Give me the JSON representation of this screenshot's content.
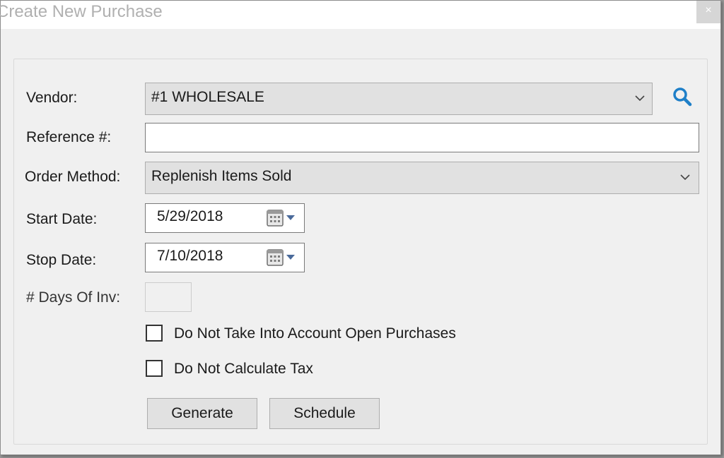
{
  "window": {
    "title": "Create New Purchase",
    "close_glyph": "×"
  },
  "form": {
    "vendor": {
      "label": "Vendor:",
      "value": "#1 WHOLESALE",
      "search_icon": "search-icon"
    },
    "reference": {
      "label": "Reference #:",
      "value": ""
    },
    "order_method": {
      "label": "Order Method:",
      "value": "Replenish Items Sold"
    },
    "start_date": {
      "label": "Start Date:",
      "value": "5/29/2018"
    },
    "stop_date": {
      "label": "Stop Date:",
      "value": "7/10/2018"
    },
    "days_of_inv": {
      "label": "# Days Of Inv:",
      "value": ""
    },
    "checkboxes": [
      {
        "label": "Do Not Take Into Account Open Purchases",
        "checked": false
      },
      {
        "label": "Do Not Calculate Tax",
        "checked": false
      }
    ],
    "buttons": {
      "generate": "Generate",
      "schedule": "Schedule"
    }
  },
  "colors": {
    "accent_icon": "#1e7fc8",
    "window_bg": "#f0f0f0",
    "control_bg": "#e1e1e1"
  }
}
